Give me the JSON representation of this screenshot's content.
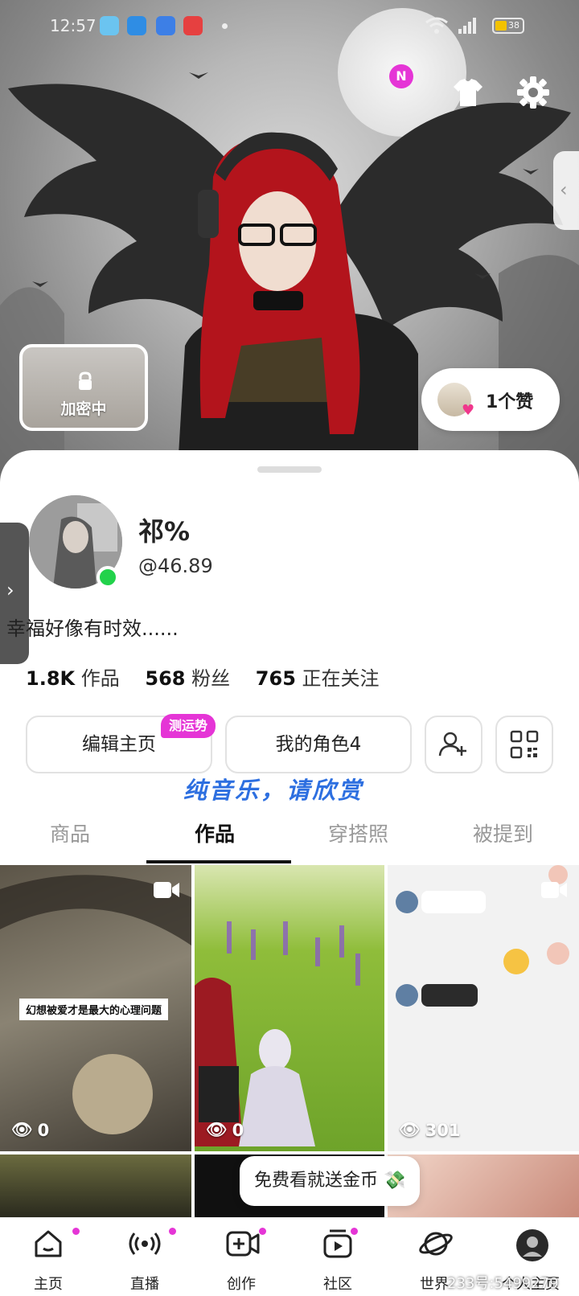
{
  "status_bar": {
    "time": "12:57",
    "battery": "38"
  },
  "header": {
    "notif_badge": "N",
    "locked_card_label": "加密中",
    "likes_label": "1个赞"
  },
  "profile": {
    "name": "祁%",
    "handle": "@46.89",
    "bio": "幸福好像有时效......",
    "stats": [
      {
        "value": "1.8K",
        "label": "作品"
      },
      {
        "value": "568",
        "label": "粉丝"
      },
      {
        "value": "765",
        "label": "正在关注"
      }
    ]
  },
  "actions": {
    "edit_label": "编辑主页",
    "fortune_badge": "测运势",
    "role_label": "我的角色4"
  },
  "banner": "纯音乐，请欣赏",
  "tabs": [
    {
      "label": "商品",
      "active": false
    },
    {
      "label": "作品",
      "active": true
    },
    {
      "label": "穿搭照",
      "active": false
    },
    {
      "label": "被提到",
      "active": false
    }
  ],
  "grid": [
    {
      "views": "0",
      "caption": "幻想被爱才是最大的心理问题"
    },
    {
      "views": "0"
    },
    {
      "views": "301"
    }
  ],
  "promo": "免费看就送金币 💸",
  "bottom_nav": [
    {
      "label": "主页",
      "icon": "home-icon"
    },
    {
      "label": "直播",
      "icon": "live-icon"
    },
    {
      "label": "创作",
      "icon": "create-icon"
    },
    {
      "label": "社区",
      "icon": "community-icon"
    },
    {
      "label": "世界",
      "icon": "planet-icon"
    },
    {
      "label": "个人主页",
      "icon": "profile-icon"
    }
  ],
  "watermark": "233号:5499279",
  "colors": {
    "accent": "#e535d6",
    "online": "#22d24b",
    "banner": "#2d6fe0"
  }
}
